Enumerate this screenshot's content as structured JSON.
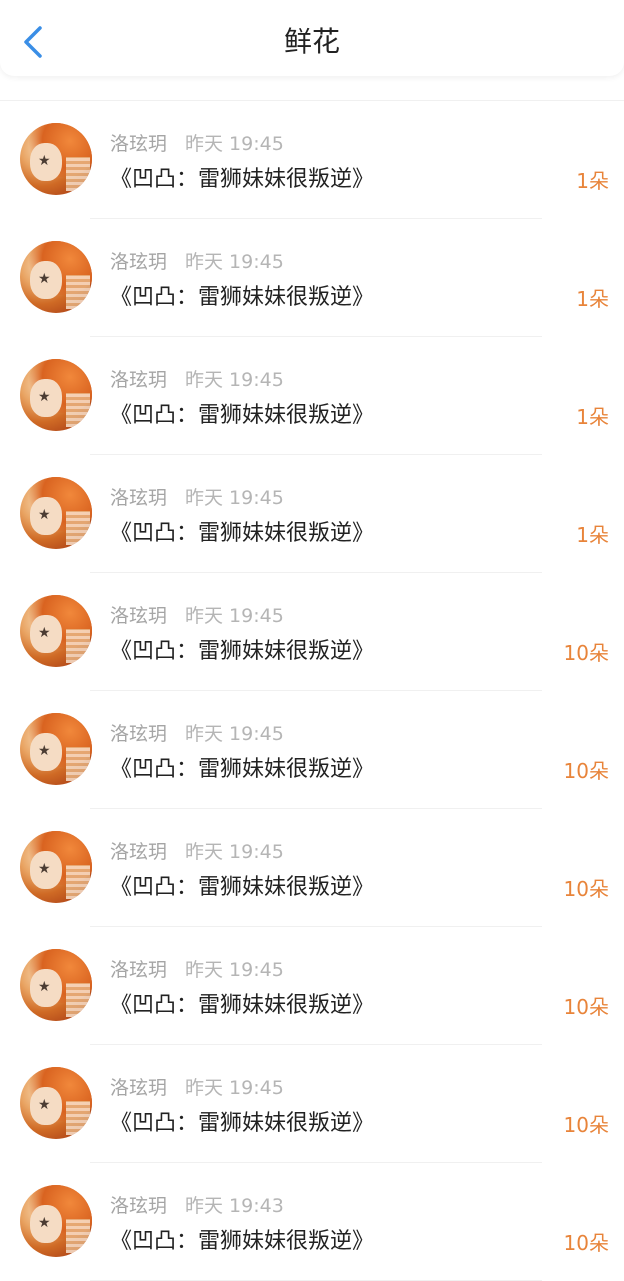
{
  "header": {
    "title": "鲜花",
    "back_icon": "chevron-left-icon",
    "accent": "#3a8ee6"
  },
  "colors": {
    "count": "#e8843a",
    "meta": "#a5a5a5"
  },
  "items": [
    {
      "user": "洛玹玥",
      "time": "昨天 19:45",
      "book": "《凹凸：雷狮妹妹很叛逆》",
      "count": "1朵"
    },
    {
      "user": "洛玹玥",
      "time": "昨天 19:45",
      "book": "《凹凸：雷狮妹妹很叛逆》",
      "count": "1朵"
    },
    {
      "user": "洛玹玥",
      "time": "昨天 19:45",
      "book": "《凹凸：雷狮妹妹很叛逆》",
      "count": "1朵"
    },
    {
      "user": "洛玹玥",
      "time": "昨天 19:45",
      "book": "《凹凸：雷狮妹妹很叛逆》",
      "count": "1朵"
    },
    {
      "user": "洛玹玥",
      "time": "昨天 19:45",
      "book": "《凹凸：雷狮妹妹很叛逆》",
      "count": "10朵"
    },
    {
      "user": "洛玹玥",
      "time": "昨天 19:45",
      "book": "《凹凸：雷狮妹妹很叛逆》",
      "count": "10朵"
    },
    {
      "user": "洛玹玥",
      "time": "昨天 19:45",
      "book": "《凹凸：雷狮妹妹很叛逆》",
      "count": "10朵"
    },
    {
      "user": "洛玹玥",
      "time": "昨天 19:45",
      "book": "《凹凸：雷狮妹妹很叛逆》",
      "count": "10朵"
    },
    {
      "user": "洛玹玥",
      "time": "昨天 19:45",
      "book": "《凹凸：雷狮妹妹很叛逆》",
      "count": "10朵"
    },
    {
      "user": "洛玹玥",
      "time": "昨天 19:43",
      "book": "《凹凸：雷狮妹妹很叛逆》",
      "count": "10朵"
    }
  ]
}
